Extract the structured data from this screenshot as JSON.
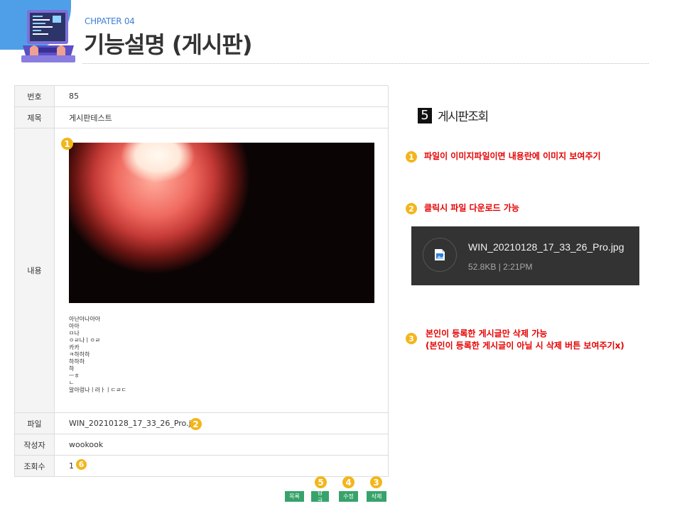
{
  "header": {
    "chapter": "CHPATER 04",
    "title": "기능설명 (게시판)"
  },
  "board": {
    "rows": {
      "number": {
        "label": "번호",
        "value": "85"
      },
      "subject": {
        "label": "제목",
        "value": "게시판테스트"
      },
      "content": {
        "label": "내용",
        "text": "아난아나아아\n아아\nㅁ나\nㅇㄹ나ㅣㅇㄹ\n카카\nㅋ하하하\n하하하\n하\nㅡㅎ\nㄴ\n알아렁나ㅣ러ㅏㅣㄷㄹㄷ"
      },
      "file": {
        "label": "파일",
        "value": "WIN_20210128_17_33_26_Pro.jpg"
      },
      "author": {
        "label": "작성자",
        "value": "wookook"
      },
      "views": {
        "label": "조회수",
        "value": "1"
      }
    },
    "buttons": {
      "list": "목록",
      "reply": "답글",
      "edit": "수정",
      "delete": "삭제"
    }
  },
  "badges": {
    "b1": "1",
    "b2": "2",
    "b3": "3",
    "b4": "4",
    "b5": "5",
    "b6": "6"
  },
  "panel": {
    "section_number": "5",
    "section_title": "게시판조회",
    "note1": "파일이 이미지파일이면 내용란에 이미지 보여주기",
    "note2": "클릭시 파일 다운로드 가능",
    "note3_line1": "본인이 등록한 게시글만 삭제 가능",
    "note3_line2": "(본인이 등록한 게시글이 아닐 시 삭제 버튼 보여주기x)",
    "download": {
      "file_name": "WIN_20210128_17_33_26_Pro.jpg",
      "meta": "52.8KB | 2:21PM"
    }
  },
  "colors": {
    "accent_blue": "#4f9fe8",
    "badge": "#f3b51a",
    "button": "#37a36b",
    "note_red": "#e60000"
  }
}
